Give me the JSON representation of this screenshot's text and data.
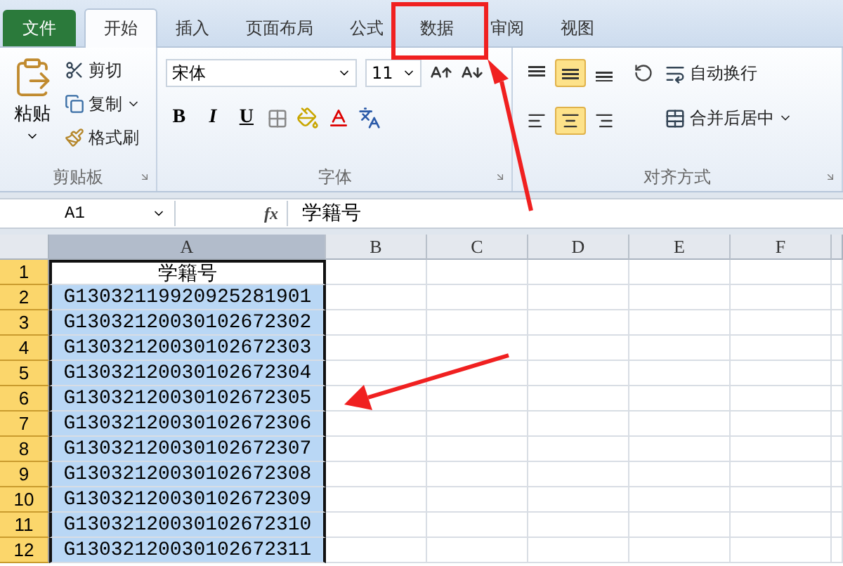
{
  "tabs": [
    {
      "label": "文件",
      "kind": "file",
      "selected": false
    },
    {
      "label": "开始",
      "kind": "tab",
      "selected": true
    },
    {
      "label": "插入",
      "kind": "tab",
      "selected": false
    },
    {
      "label": "页面布局",
      "kind": "tab",
      "selected": false
    },
    {
      "label": "公式",
      "kind": "tab",
      "selected": false
    },
    {
      "label": "数据",
      "kind": "tab",
      "selected": false
    },
    {
      "label": "审阅",
      "kind": "tab",
      "selected": false
    },
    {
      "label": "视图",
      "kind": "tab",
      "selected": false
    }
  ],
  "clipboard": {
    "paste": "粘贴",
    "cut": "剪切",
    "copy": "复制",
    "format_painter": "格式刷",
    "label": "剪贴板"
  },
  "font": {
    "name": "宋体",
    "size": "11",
    "bold": "B",
    "italic": "I",
    "underline": "U",
    "label": "字体"
  },
  "alignment": {
    "vertical": [
      {
        "selected": false
      },
      {
        "selected": true
      },
      {
        "selected": false
      }
    ],
    "horizontal": [
      {
        "selected": false
      },
      {
        "selected": true
      },
      {
        "selected": false
      }
    ],
    "wrap": "自动换行",
    "merge": "合并后居中",
    "label": "对齐方式"
  },
  "formula_bar": {
    "name_box": "A1",
    "fx": "fx",
    "content": "学籍号"
  },
  "sheet": {
    "columns": [
      {
        "label": "A",
        "selected": true
      },
      {
        "label": "B",
        "selected": false
      },
      {
        "label": "C",
        "selected": false
      },
      {
        "label": "D",
        "selected": false
      },
      {
        "label": "E",
        "selected": false
      },
      {
        "label": "F",
        "selected": false
      }
    ],
    "rows": [
      {
        "number": "1",
        "selected": true,
        "active": true,
        "value": "学籍号"
      },
      {
        "number": "2",
        "selected": true,
        "active": false,
        "value": "G13032119920925281901"
      },
      {
        "number": "3",
        "selected": true,
        "active": false,
        "value": "G13032120030102672302"
      },
      {
        "number": "4",
        "selected": true,
        "active": false,
        "value": "G13032120030102672303"
      },
      {
        "number": "5",
        "selected": true,
        "active": false,
        "value": "G13032120030102672304"
      },
      {
        "number": "6",
        "selected": true,
        "active": false,
        "value": "G13032120030102672305"
      },
      {
        "number": "7",
        "selected": true,
        "active": false,
        "value": "G13032120030102672306"
      },
      {
        "number": "8",
        "selected": true,
        "active": false,
        "value": "G13032120030102672307"
      },
      {
        "number": "9",
        "selected": true,
        "active": false,
        "value": "G13032120030102672308"
      },
      {
        "number": "10",
        "selected": true,
        "active": false,
        "value": "G13032120030102672309"
      },
      {
        "number": "11",
        "selected": true,
        "active": false,
        "value": "G13032120030102672310"
      },
      {
        "number": "12",
        "selected": true,
        "active": false,
        "value": "G13032120030102672311"
      }
    ]
  }
}
